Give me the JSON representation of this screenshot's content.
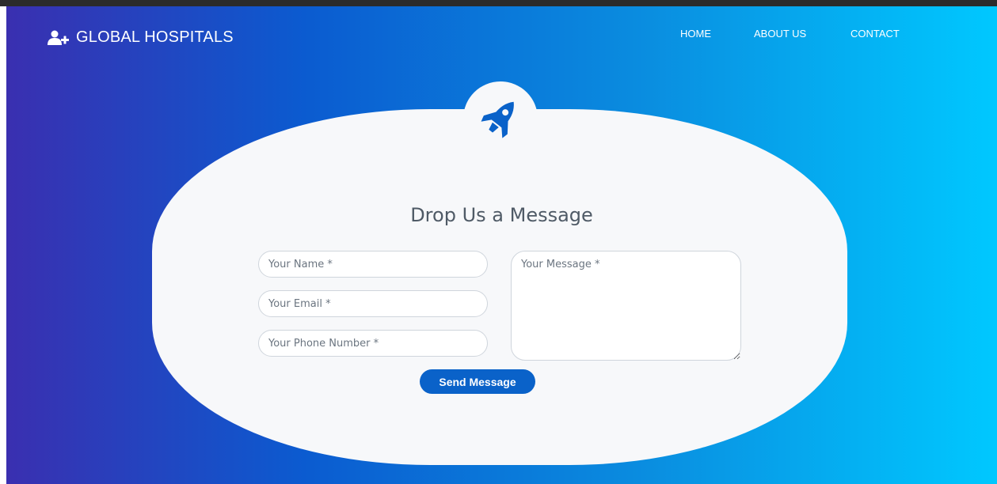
{
  "brand": {
    "name": "GLOBAL HOSPITALS",
    "icon": "user-plus-icon"
  },
  "nav": {
    "items": [
      "HOME",
      "ABOUT US",
      "CONTACT"
    ]
  },
  "form": {
    "icon": "rocket-icon",
    "title": "Drop Us a Message",
    "name_placeholder": "Your Name *",
    "email_placeholder": "Your Email *",
    "phone_placeholder": "Your Phone Number *",
    "message_placeholder": "Your Message *",
    "submit_label": "Send Message"
  },
  "colors": {
    "gradient_start": "#3a2fb0",
    "gradient_mid": "#0b5bd0",
    "gradient_end": "#00c8ff",
    "card": "#f7f8fa",
    "button": "#0a62c9",
    "rocket": "#0a62c9"
  }
}
